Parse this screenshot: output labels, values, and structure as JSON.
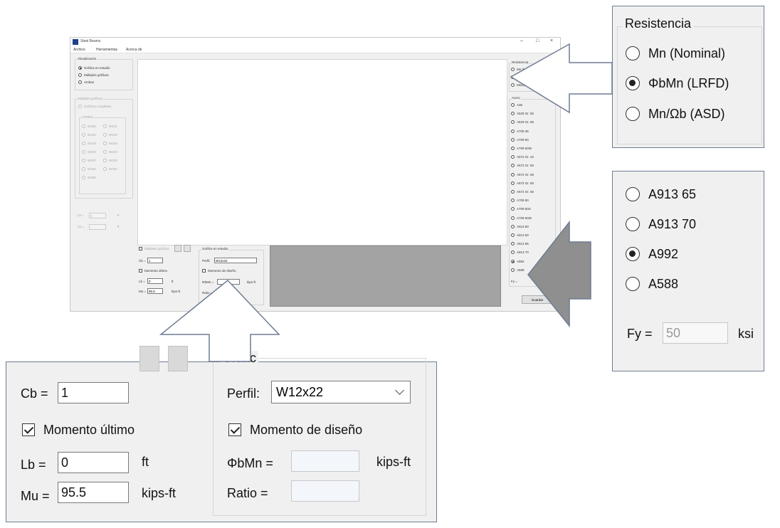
{
  "app": {
    "title": "Steel Beams",
    "menu": [
      "Archivo",
      "Herramientas",
      "Acerca de"
    ],
    "window_controls": [
      "–",
      "□",
      "×"
    ],
    "visualizacion": {
      "legend": "Visualización",
      "options": [
        "Gráfica en estudio",
        "Múltiples gráficas",
        "Ambas"
      ],
      "selected": 0
    },
    "multiples": {
      "legend": "Múltiples gráficas",
      "options": [
        "Gráficas completas",
        "Perfiles"
      ],
      "perfiles": [
        "W100",
        "W110",
        "W120",
        "W130",
        "W140",
        "W150",
        "W200",
        "W210",
        "W220",
        "W230",
        "W240",
        "W250",
        "W260"
      ]
    },
    "left_fields": [
      {
        "label": "Lb =",
        "value": "0",
        "unit": "ft"
      },
      {
        "label": "Lb =",
        "value": "",
        "unit": "ft"
      }
    ],
    "bottom_mid": {
      "checkbox_label": "Múltiples gráficas",
      "cb_label": "Cb =",
      "cb_value": "1",
      "mom_ultimo": "Momento último",
      "lb_label": "Lb =",
      "lb_value": "0",
      "lb_unit": "ft",
      "mu_label": "Mu =",
      "mu_value": "95.5",
      "mu_unit": "kips-ft"
    },
    "bottom_graf": {
      "legend": "Gráfica en estudio",
      "perfil_label": "Perfil:",
      "perfil_value": "W12x22",
      "mom_diseno": "Momento de diseño",
      "phibmn_label": "ΦbMn =",
      "phibmn_unit": "kips-ft",
      "ratio_label": "Ratio ="
    },
    "resistencia_legend": "Resistencia",
    "resistencia_short": [
      "Mn (Nominal)",
      "ΦbMn (LRFD)",
      "Mn/Ωb (ASD)"
    ],
    "acero_legend": "Acero",
    "acero_options": [
      "A36",
      "A529 Gr. 50",
      "A529 Gr. 55",
      "A709 36",
      "A709 50",
      "A709 50W",
      "A572 Gr. 42",
      "A572 Gr. 50",
      "A572 Gr. 55",
      "A572 Gr. 60",
      "A572 Gr. 65",
      "A709 50",
      "A709 50S",
      "A709 50W",
      "A913 50",
      "A913 60",
      "A913 65",
      "A913 70",
      "A992",
      "A588"
    ],
    "acero_selected": 18,
    "fy_small": "Fy =",
    "button_label": "Guardar"
  },
  "zoom_resistencia": {
    "legend": "Resistencia",
    "options": [
      "Mn (Nominal)",
      "ΦbMn (LRFD)",
      "Mn/Ωb (ASD)"
    ],
    "selected": 1
  },
  "zoom_acero": {
    "options": [
      "A913 65",
      "A913 70",
      "A992",
      "A588"
    ],
    "selected": 2,
    "fy_label": "Fy =",
    "fy_value": "50",
    "fy_unit": "ksi"
  },
  "zoom_bottom": {
    "cb_label": "Cb =",
    "cb_value": "1",
    "mom_ultimo": "Momento último",
    "lb_label": "Lb =",
    "lb_value": "0",
    "lb_unit": "ft",
    "mu_label": "Mu =",
    "mu_value": "95.5",
    "mu_unit": "kips-ft",
    "graf_legend": "Gráfic",
    "perfil_label": "Perfil:",
    "perfil_value": "W12x22",
    "mom_diseno": "Momento de diseño",
    "phibmn_label": "ΦbMn =",
    "phibmn_unit": "kips-ft",
    "ratio_label": "Ratio ="
  },
  "colors": {
    "window_bg": "#f0f0f0",
    "zoom_border": "#6f7c94",
    "gray_panel": "#a3a3a3",
    "arrow_fill": "#8f8f8f"
  }
}
